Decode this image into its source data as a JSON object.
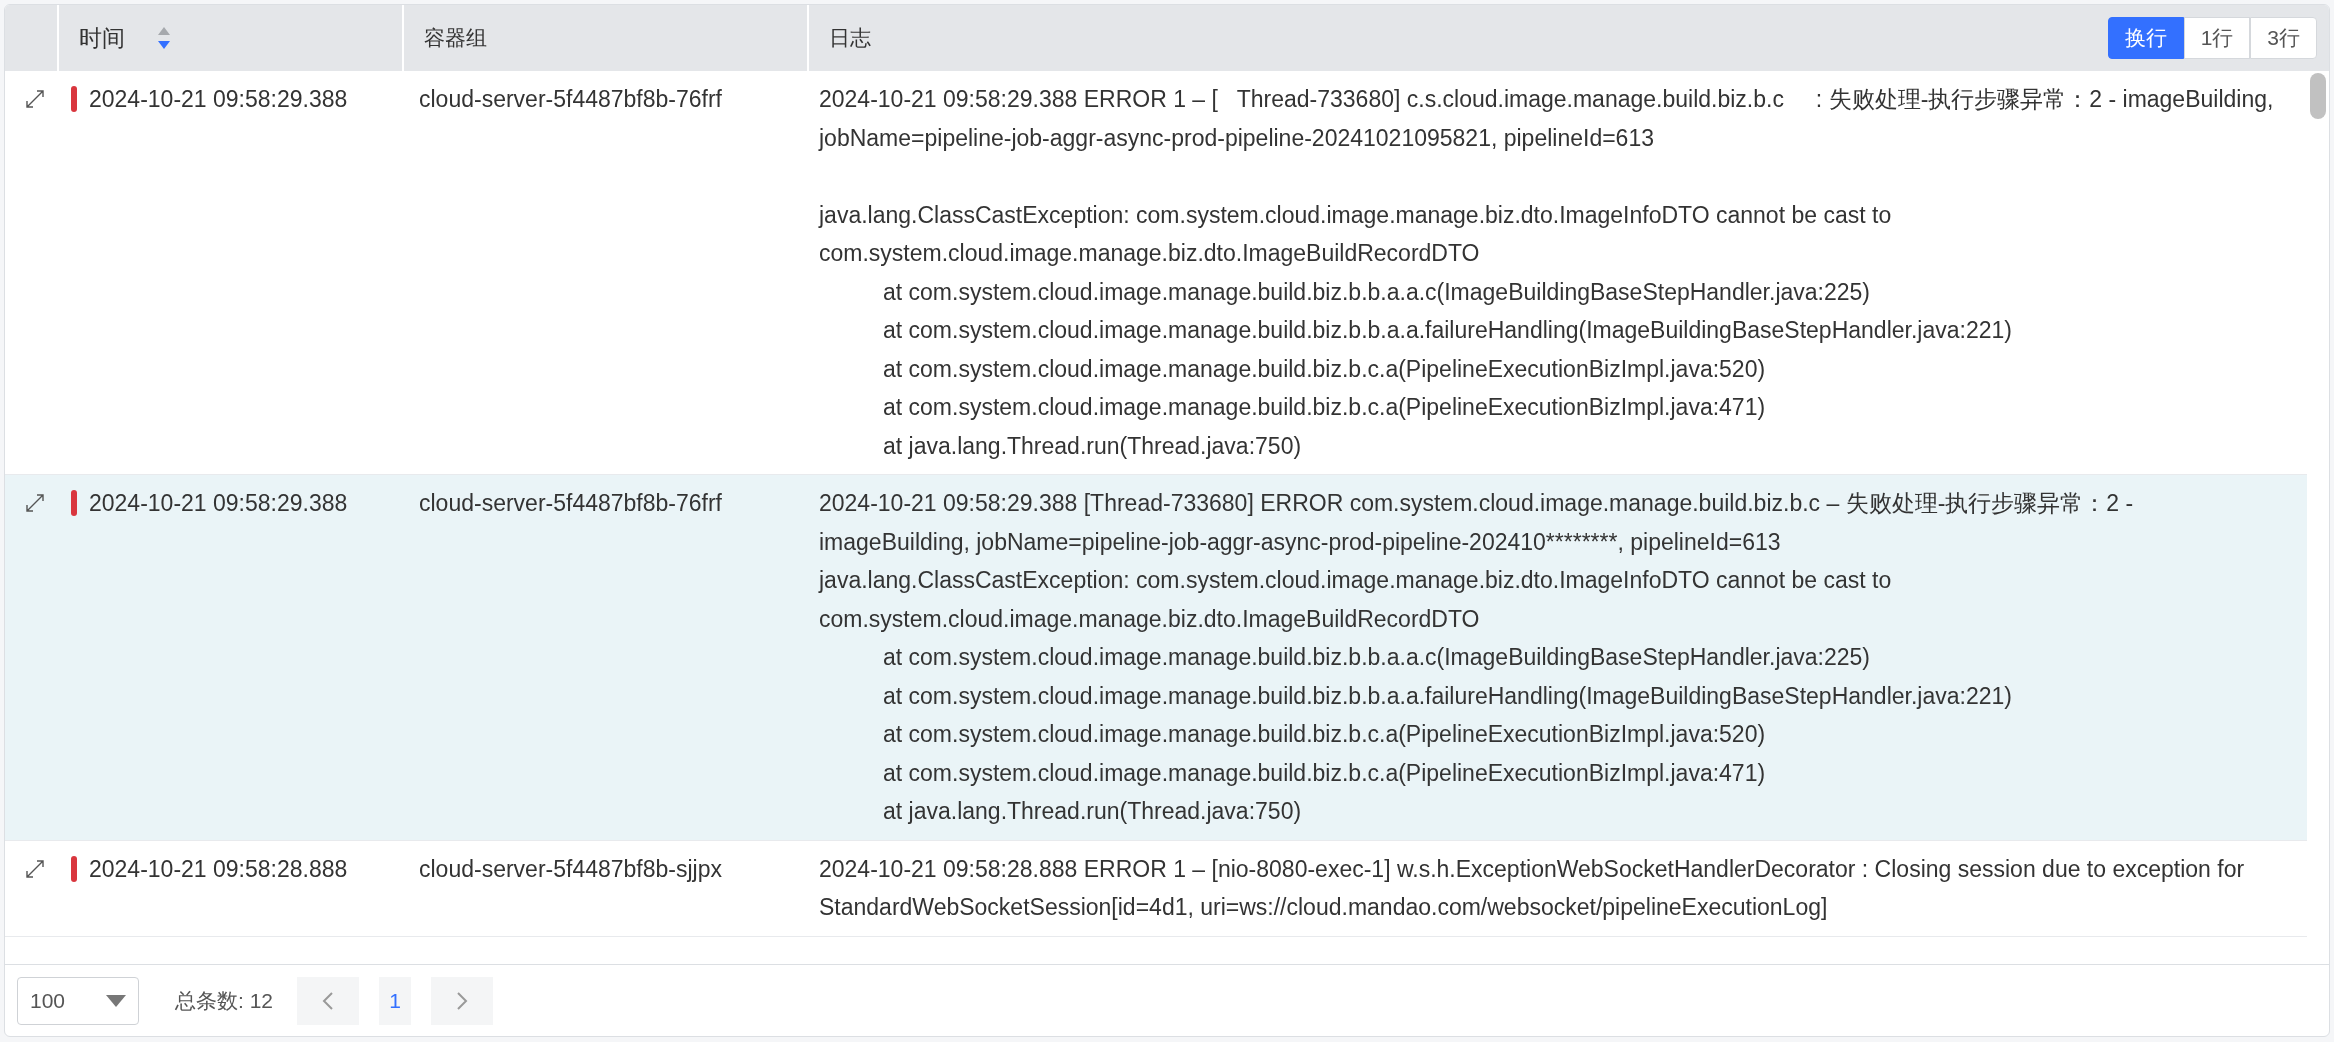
{
  "table": {
    "columns": [
      {
        "label": "时间",
        "sorted_descending": true
      },
      {
        "label": "容器组"
      },
      {
        "label": "日志"
      }
    ],
    "wrap_modes": [
      {
        "label": "换行",
        "selected": true
      },
      {
        "label": "1行",
        "selected": false
      },
      {
        "label": "3行",
        "selected": false
      }
    ],
    "rows": [
      {
        "selected": false,
        "color": "#d9363e",
        "time": "2024-10-21 09:58:29.388",
        "pod": "cloud-server-5f4487bf8b-76frf",
        "log": [
          {
            "lines": [
              {
                "kind": "text",
                "text": "2024-10-21 09:58:29.388 ERROR 1 – [   Thread-733680] c.s.cloud.image.manage.build.biz.b.c     : 失败处理-执行步骤异常：2 - imageBuilding, jobName=pipeline-job-aggr-async-prod-pipeline-20241021095821, pipelineId=613"
              }
            ]
          },
          {
            "lines": [
              {
                "kind": "text",
                "text": "java.lang.ClassCastException: com.system.cloud.image.manage.biz.dto.ImageInfoDTO cannot be cast to com.system.cloud.image.manage.biz.dto.ImageBuildRecordDTO"
              },
              {
                "kind": "frame",
                "text": "at com.system.cloud.image.manage.build.biz.b.b.a.a.c(ImageBuildingBaseStepHandler.java:225)"
              },
              {
                "kind": "frame",
                "text": "at com.system.cloud.image.manage.build.biz.b.b.a.a.failureHandling(ImageBuildingBaseStepHandler.java:221)"
              },
              {
                "kind": "frame",
                "text": "at com.system.cloud.image.manage.build.biz.b.c.a(PipelineExecutionBizImpl.java:520)"
              },
              {
                "kind": "frame",
                "text": "at com.system.cloud.image.manage.build.biz.b.c.a(PipelineExecutionBizImpl.java:471)"
              },
              {
                "kind": "frame",
                "text": "at java.lang.Thread.run(Thread.java:750)"
              }
            ]
          }
        ]
      },
      {
        "selected": true,
        "color": "#d9363e",
        "time": "2024-10-21 09:58:29.388",
        "pod": "cloud-server-5f4487bf8b-76frf",
        "log": [
          {
            "lines": [
              {
                "kind": "text",
                "text": "2024-10-21 09:58:29.388 [Thread-733680] ERROR com.system.cloud.image.manage.build.biz.b.c – 失败处理-执行步骤异常：2 - imageBuilding, jobName=pipeline-job-aggr-async-prod-pipeline-202410********, pipelineId=613"
              },
              {
                "kind": "text",
                "text": "java.lang.ClassCastException: com.system.cloud.image.manage.biz.dto.ImageInfoDTO cannot be cast to com.system.cloud.image.manage.biz.dto.ImageBuildRecordDTO"
              },
              {
                "kind": "frame",
                "text": "at com.system.cloud.image.manage.build.biz.b.b.a.a.c(ImageBuildingBaseStepHandler.java:225)"
              },
              {
                "kind": "frame",
                "text": "at com.system.cloud.image.manage.build.biz.b.b.a.a.failureHandling(ImageBuildingBaseStepHandler.java:221)"
              },
              {
                "kind": "frame",
                "text": "at com.system.cloud.image.manage.build.biz.b.c.a(PipelineExecutionBizImpl.java:520)"
              },
              {
                "kind": "frame",
                "text": "at com.system.cloud.image.manage.build.biz.b.c.a(PipelineExecutionBizImpl.java:471)"
              },
              {
                "kind": "frame",
                "text": "at java.lang.Thread.run(Thread.java:750)"
              }
            ]
          }
        ]
      },
      {
        "selected": false,
        "color": "#d9363e",
        "time": "2024-10-21 09:58:28.888",
        "pod": "cloud-server-5f4487bf8b-sjjpx",
        "log": [
          {
            "lines": [
              {
                "kind": "text",
                "text": "2024-10-21 09:58:28.888 ERROR 1 – [nio-8080-exec-1] w.s.h.ExceptionWebSocketHandlerDecorator : Closing session due to exception for StandardWebSocketSession[id=4d1, uri=ws://cloud.mandao.com/websocket/pipelineExecutionLog]"
              }
            ]
          }
        ]
      }
    ]
  },
  "pagination": {
    "page_size": "100",
    "total": "总条数: 12",
    "pages": [
      {
        "label": "1",
        "selected": true
      }
    ]
  }
}
